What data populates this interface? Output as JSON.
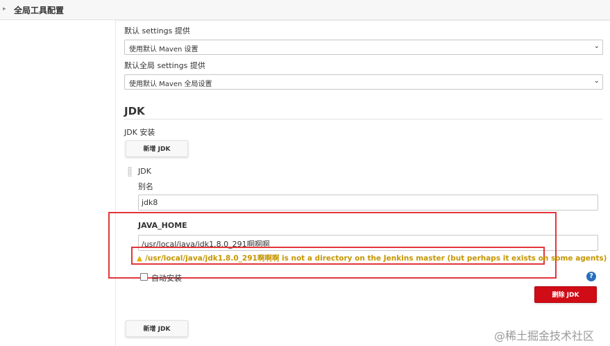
{
  "header": {
    "title": "全局工具配置"
  },
  "maven": {
    "settings_label": "默认 settings 提供",
    "settings_value": "使用默认 Maven 设置",
    "global_settings_label": "默认全局 settings 提供",
    "global_settings_value": "使用默认 Maven 全局设置"
  },
  "jdk": {
    "section_title": "JDK",
    "install_label": "JDK 安装",
    "add_button_label": "新增 JDK",
    "item_title": "JDK",
    "alias_label": "别名",
    "alias_value": "jdk8",
    "java_home_label": "JAVA_HOME",
    "java_home_value": "/usr/local/java/jdk1.8.0_291啊啊啊",
    "warning_text": "/usr/local/java/jdk1.8.0_291啊啊啊 is not a directory on the Jenkins master (but perhaps it exists on some agents)",
    "auto_install_label": "自动安装",
    "delete_button_label": "删除 JDK",
    "add_button_bottom_label": "新增 JDK"
  },
  "watermark": "@稀土掘金技术社区",
  "icons": {
    "dropdown": "chevron-down-icon",
    "warning": "warning-icon",
    "help": "help-icon",
    "drag": "drag-handle-icon",
    "breadcrumb": "chevron-right-icon"
  },
  "colors": {
    "danger": "#d00c16",
    "warning": "#c59600",
    "highlight_box": "#e2353b",
    "help": "#2a6ebb"
  }
}
